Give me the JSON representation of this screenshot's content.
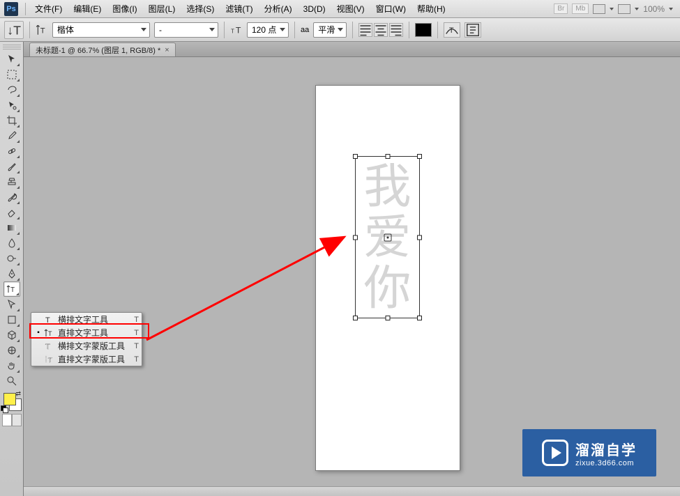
{
  "menu": {
    "items": [
      {
        "label": "文件(F)"
      },
      {
        "label": "编辑(E)"
      },
      {
        "label": "图像(I)"
      },
      {
        "label": "图层(L)"
      },
      {
        "label": "选择(S)"
      },
      {
        "label": "滤镜(T)"
      },
      {
        "label": "分析(A)"
      },
      {
        "label": "3D(D)"
      },
      {
        "label": "视图(V)"
      },
      {
        "label": "窗口(W)"
      },
      {
        "label": "帮助(H)"
      }
    ],
    "logo": "Ps",
    "zoom_label": "100%"
  },
  "options": {
    "font_family": "楷体",
    "font_style": "-",
    "font_size": "120 点",
    "aa_prefix": "aa",
    "aa_mode": "平滑"
  },
  "tabs": {
    "doc": {
      "title": "未标题-1 @ 66.7% (图层 1, RGB/8) *"
    }
  },
  "tools": [
    {
      "name": "move-tool",
      "icon": "move"
    },
    {
      "name": "marquee-tool",
      "icon": "marquee"
    },
    {
      "name": "lasso-tool",
      "icon": "lasso"
    },
    {
      "name": "magic-wand-tool",
      "icon": "wand"
    },
    {
      "name": "crop-tool",
      "icon": "crop"
    },
    {
      "name": "eyedropper-tool",
      "icon": "eyedrop"
    },
    {
      "name": "healing-brush-tool",
      "icon": "bandage"
    },
    {
      "name": "brush-tool",
      "icon": "brush"
    },
    {
      "name": "clone-stamp-tool",
      "icon": "stamp"
    },
    {
      "name": "history-brush-tool",
      "icon": "histbrush"
    },
    {
      "name": "eraser-tool",
      "icon": "eraser"
    },
    {
      "name": "gradient-tool",
      "icon": "gradient"
    },
    {
      "name": "blur-tool",
      "icon": "drop"
    },
    {
      "name": "dodge-tool",
      "icon": "dodge"
    },
    {
      "name": "pen-tool",
      "icon": "pen"
    },
    {
      "name": "text-tool",
      "icon": "vtext",
      "active": true
    },
    {
      "name": "path-selection-tool",
      "icon": "patharrow"
    },
    {
      "name": "rectangle-tool",
      "icon": "rect"
    },
    {
      "name": "3d-tool",
      "icon": "cube"
    },
    {
      "name": "3d-camera-tool",
      "icon": "orbit"
    },
    {
      "name": "hand-tool",
      "icon": "hand"
    },
    {
      "name": "zoom-tool",
      "icon": "zoom"
    }
  ],
  "colors": {
    "fg": "#fff04a",
    "bg": "#ffffff"
  },
  "flyout": {
    "items": [
      {
        "selected": false,
        "icon": "htext",
        "label": "横排文字工具",
        "shortcut": "T"
      },
      {
        "selected": true,
        "icon": "vtext",
        "label": "直排文字工具",
        "shortcut": "T"
      },
      {
        "selected": false,
        "icon": "hmask",
        "label": "横排文字蒙版工具",
        "shortcut": "T"
      },
      {
        "selected": false,
        "icon": "vmask",
        "label": "直排文字蒙版工具",
        "shortcut": "T"
      }
    ]
  },
  "canvas": {
    "text_chars": [
      "我",
      "爱",
      "你"
    ]
  },
  "watermark": {
    "title": "溜溜自学",
    "subtitle": "zixue.3d66.com"
  },
  "right_boxes": {
    "a": "Br",
    "b": "Mb"
  }
}
